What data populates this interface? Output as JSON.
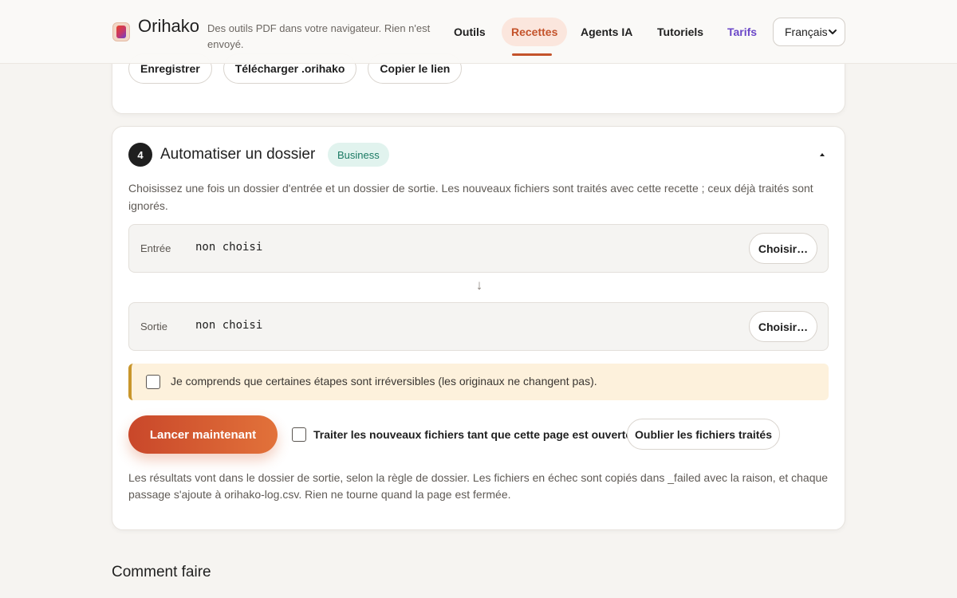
{
  "header": {
    "brand": "Orihako",
    "tagline": "Des outils PDF dans votre navigateur. Rien n'est envoyé.",
    "nav": {
      "outils": "Outils",
      "recettes": "Recettes",
      "agents": "Agents IA",
      "tutoriels": "Tutoriels",
      "tarifs": "Tarifs"
    },
    "language": "Français"
  },
  "previous_step": {
    "save_label": "Enregistrer",
    "download_label": "Télécharger .orihako",
    "copy_link_label": "Copier le lien"
  },
  "automation": {
    "step_number": "4",
    "title": "Automatiser un dossier",
    "badge": "Business",
    "description": "Choisissez une fois un dossier d'entrée et un dossier de sortie. Les nouveaux fichiers sont traités avec cette recette ; ceux déjà traités sont ignorés.",
    "input": {
      "label": "Entrée",
      "value": "non choisi",
      "button": "Choisir…"
    },
    "arrow": "↓",
    "output": {
      "label": "Sortie",
      "value": "non choisi",
      "button": "Choisir…"
    },
    "acknowledge_text": "Je comprends que certaines étapes sont irréversibles (les originaux ne changent pas).",
    "run_button": "Lancer maintenant",
    "watch_text": "Traiter les nouveaux fichiers tant que cette page est ouverte",
    "forget_button": "Oublier les fichiers traités",
    "footer_note": "Les résultats vont dans le dossier de sortie, selon la règle de dossier. Les fichiers en échec sont copiés dans _failed avec la raison, et chaque passage s'ajoute à orihako-log.csv. Rien ne tourne quand la page est fermée."
  },
  "how_to": {
    "title": "Comment faire"
  },
  "colors": {
    "accent": "#c4532b",
    "tarifs": "#6b47c8",
    "badge_bg": "#e1f3ee",
    "warning_bg": "#fdf1dc"
  }
}
